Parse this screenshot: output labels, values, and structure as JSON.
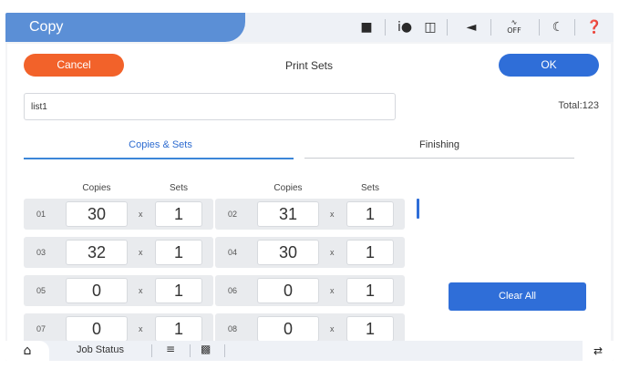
{
  "header": {
    "title": "Copy",
    "icons": [
      "memory-device-icon",
      "info-icon",
      "wifi-direct-icon",
      "sound-icon",
      "network-off-icon",
      "sleep-icon",
      "help-icon"
    ],
    "network_off_text": "OFF"
  },
  "sheet": {
    "title": "Print Sets",
    "cancel_label": "Cancel",
    "ok_label": "OK"
  },
  "list_name": "list1",
  "total": "Total:123",
  "tabs": [
    {
      "label": "Copies & Sets",
      "active": true
    },
    {
      "label": "Finishing",
      "active": false
    }
  ],
  "column_headers": {
    "copies": "Copies",
    "sets": "Sets"
  },
  "multiply": "x",
  "rows": [
    {
      "num": "01",
      "copies": "30",
      "sets": "1"
    },
    {
      "num": "02",
      "copies": "31",
      "sets": "1"
    },
    {
      "num": "03",
      "copies": "32",
      "sets": "1"
    },
    {
      "num": "04",
      "copies": "30",
      "sets": "1"
    },
    {
      "num": "05",
      "copies": "0",
      "sets": "1"
    },
    {
      "num": "06",
      "copies": "0",
      "sets": "1"
    },
    {
      "num": "07",
      "copies": "0",
      "sets": "1"
    },
    {
      "num": "08",
      "copies": "0",
      "sets": "1"
    }
  ],
  "clear_all_label": "Clear All",
  "footer": {
    "job_status": "Job Status"
  },
  "colors": {
    "accent_blue": "#2f6ed8",
    "cancel_orange": "#f2622a",
    "title_tab": "#5b8fd6"
  }
}
